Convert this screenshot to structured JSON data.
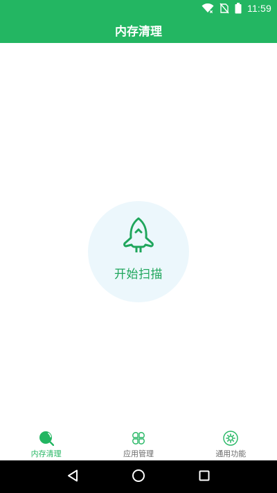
{
  "status_bar": {
    "time": "11:59",
    "icons": [
      "wifi-icon",
      "no-sim-icon",
      "battery-icon"
    ]
  },
  "app_bar": {
    "title": "内存清理"
  },
  "main": {
    "scan_button_label": "开始扫描",
    "scan_icon": "rocket-icon"
  },
  "bottom_nav": {
    "items": [
      {
        "label": "内存清理",
        "icon": "memory-clean-icon",
        "active": true
      },
      {
        "label": "应用管理",
        "icon": "app-management-icon",
        "active": false
      },
      {
        "label": "通用功能",
        "icon": "settings-gear-icon",
        "active": false
      }
    ]
  },
  "colors": {
    "primary": "#23b662",
    "accent_text": "#1fa65c",
    "circle_bg": "#ecf7fc",
    "inactive_nav": "#6b6b6b"
  }
}
